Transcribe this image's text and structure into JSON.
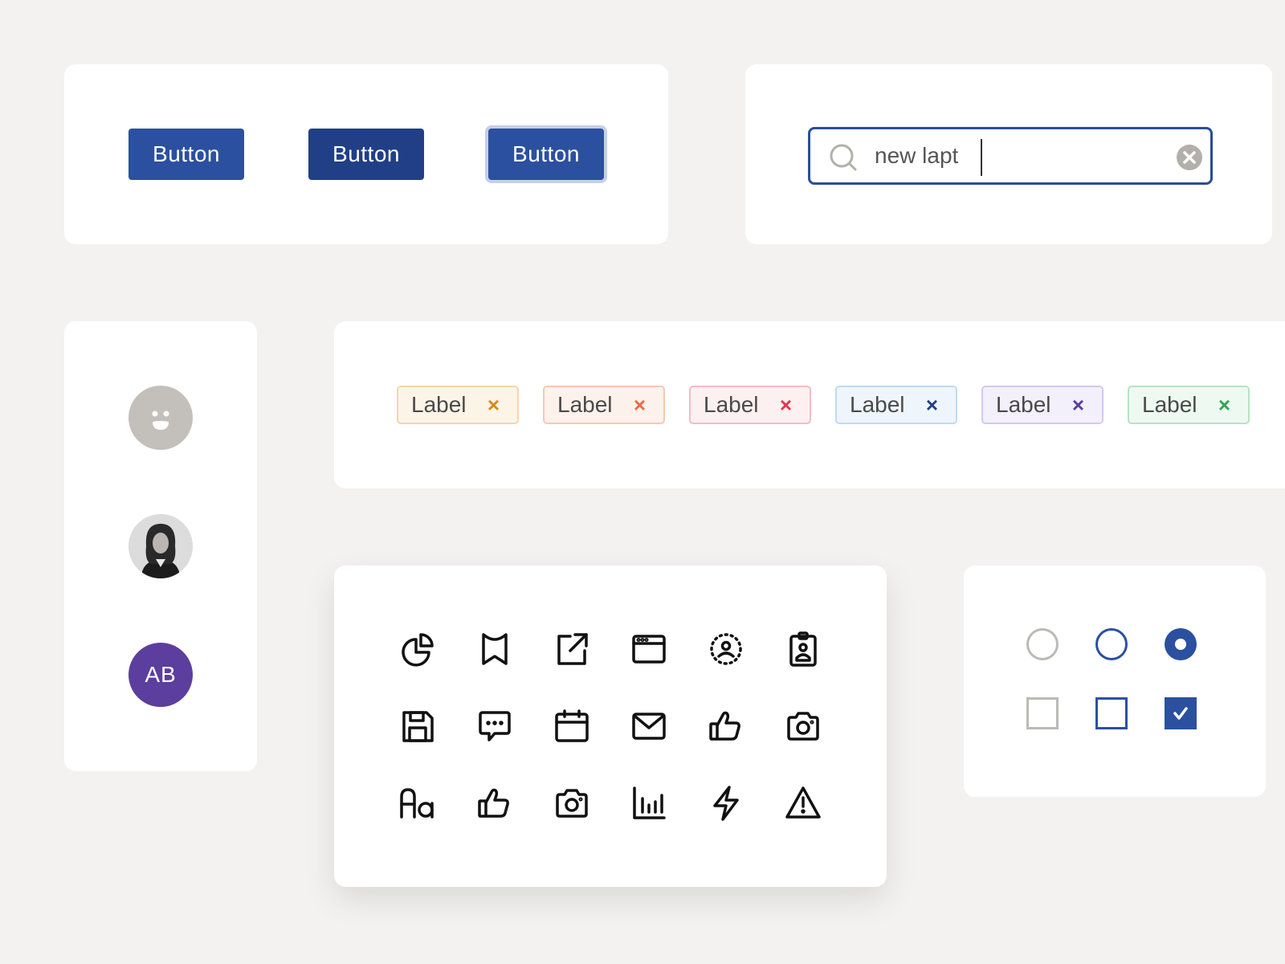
{
  "colors": {
    "primary": "#2b50a0",
    "primary_hover": "#213f87",
    "focus_ring": "#c6cfe6",
    "neutral_gray": "#bdbab5",
    "avatar_purple": "#5b3e9e"
  },
  "buttons": {
    "default_label": "Button",
    "hover_label": "Button",
    "focus_label": "Button"
  },
  "search": {
    "value": "new lapt",
    "icon": "search-icon",
    "clear_icon": "clear-circle-icon"
  },
  "avatars": {
    "placeholder_icon": "smiley-face-icon",
    "photo_alt": "user-photo",
    "initials": "AB"
  },
  "chips": [
    {
      "label": "Label",
      "close": "×",
      "bg": "#fdf4e8",
      "border": "#f3d6ac",
      "x_color": "#d8891a"
    },
    {
      "label": "Label",
      "close": "×",
      "bg": "#fdf1ec",
      "border": "#f6c8b2",
      "x_color": "#ec6b45"
    },
    {
      "label": "Label",
      "close": "×",
      "bg": "#fdf0f1",
      "border": "#f3bcc3",
      "x_color": "#e3354b"
    },
    {
      "label": "Label",
      "close": "×",
      "bg": "#eef5fc",
      "border": "#bfdaf2",
      "x_color": "#213f87"
    },
    {
      "label": "Label",
      "close": "×",
      "bg": "#f3f0fc",
      "border": "#d3c9ef",
      "x_color": "#5b3e9e"
    },
    {
      "label": "Label",
      "close": "×",
      "bg": "#eef9f1",
      "border": "#b6e3c2",
      "x_color": "#2fa655"
    }
  ],
  "icons": [
    "pie-chart-icon",
    "bookmark-icon",
    "external-link-icon",
    "browser-window-icon",
    "user-dashed-circle-icon",
    "id-badge-icon",
    "save-floppy-icon",
    "chat-bubble-icon",
    "calendar-icon",
    "mail-icon",
    "thumbs-up-icon",
    "camera-icon",
    "text-font-icon",
    "thumbs-up-icon",
    "camera-icon",
    "bar-chart-icon",
    "lightning-icon",
    "warning-triangle-icon"
  ],
  "controls": {
    "radios": [
      "unchecked-disabled",
      "unchecked",
      "checked"
    ],
    "checkboxes": [
      "unchecked-disabled",
      "unchecked",
      "checked"
    ]
  }
}
